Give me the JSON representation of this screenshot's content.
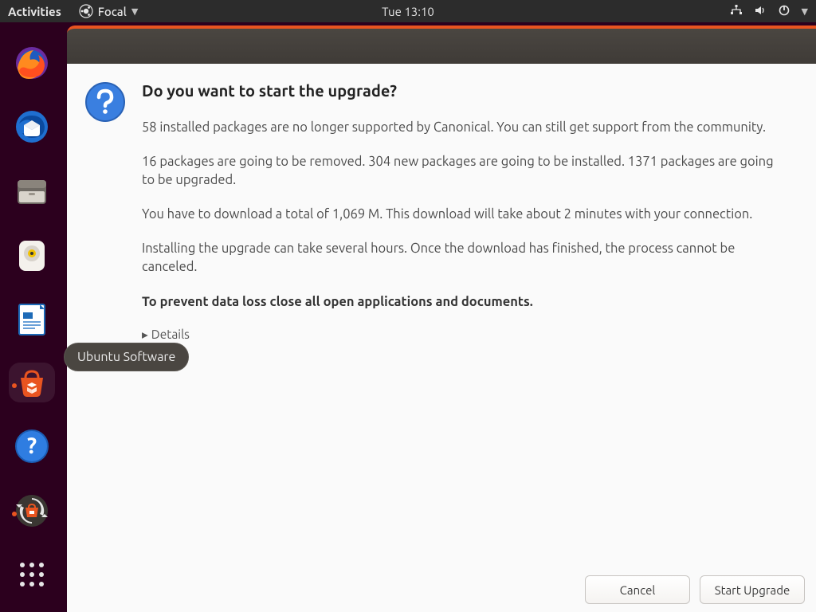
{
  "panel": {
    "activities": "Activities",
    "app_menu_label": "Focal",
    "clock": "Tue 13:10"
  },
  "dock": {
    "tooltip": "Ubuntu Software"
  },
  "dialog": {
    "title": "Do you want to start the upgrade?",
    "p1": "58 installed packages are no longer supported by Canonical. You can still get support from the community.",
    "p2": "16 packages are going to be removed. 304 new packages are going to be installed. 1371 packages are going to be upgraded.",
    "p3": "You have to download a total of 1,069 M. This download will take about 2 minutes with your connection.",
    "p4": "Installing the upgrade can take several hours. Once the download has finished, the process cannot be canceled.",
    "p5": "To prevent data loss close all open applications and documents.",
    "details_label": "Details",
    "cancel": "Cancel",
    "start": "Start Upgrade"
  }
}
